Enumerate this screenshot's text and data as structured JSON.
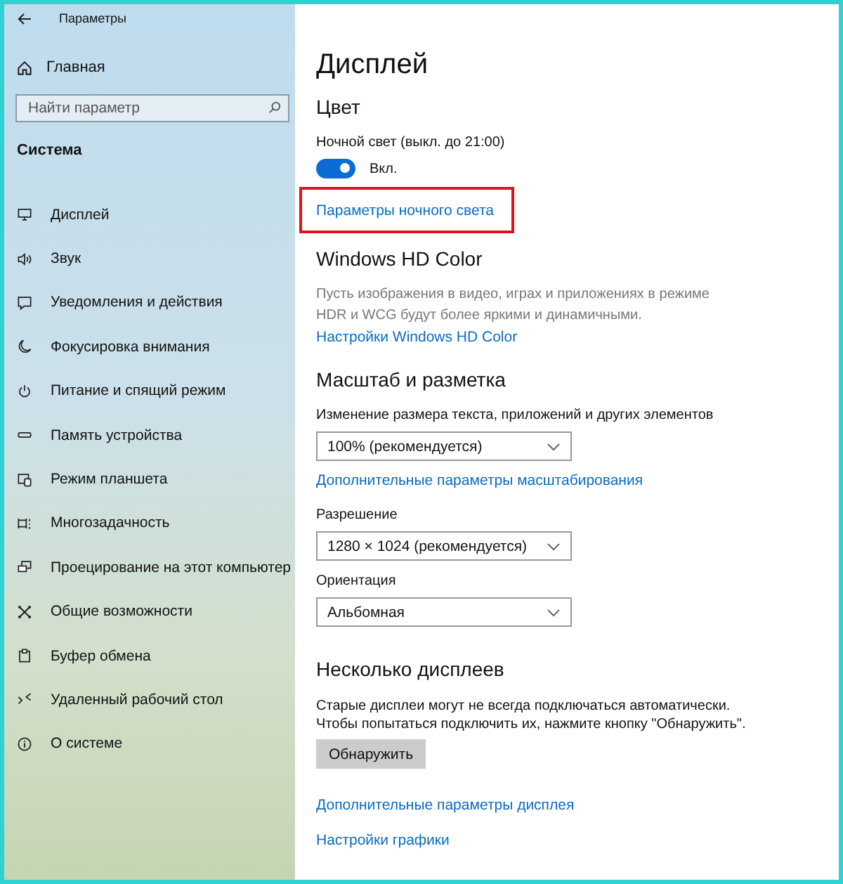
{
  "window": {
    "title": "Параметры"
  },
  "sidebar": {
    "home": "Главная",
    "search": {
      "placeholder": "Найти параметр"
    },
    "section": "Система",
    "items": [
      {
        "label": "Дисплей"
      },
      {
        "label": "Звук"
      },
      {
        "label": "Уведомления и действия"
      },
      {
        "label": "Фокусировка внимания"
      },
      {
        "label": "Питание и спящий режим"
      },
      {
        "label": "Память устройства"
      },
      {
        "label": "Режим планшета"
      },
      {
        "label": "Многозадачность"
      },
      {
        "label": "Проецирование на этот компьютер"
      },
      {
        "label": "Общие возможности"
      },
      {
        "label": "Буфер обмена"
      },
      {
        "label": "Удаленный рабочий стол"
      },
      {
        "label": "О системе"
      }
    ]
  },
  "content": {
    "title": "Дисплей",
    "color": {
      "heading": "Цвет",
      "night_light_label": "Ночной свет (выкл. до 21:00)",
      "toggle": {
        "on": true,
        "label": "Вкл."
      },
      "link": {
        "text": "Параметры ночного света",
        "highlighted": true
      }
    },
    "hd_color": {
      "heading": "Windows HD Color",
      "description": "Пусть изображения в видео, играх и приложениях в режиме HDR и WCG будут более яркими и динамичными.",
      "link": "Настройки Windows HD Color"
    },
    "scale": {
      "heading": "Масштаб и разметка",
      "scale_label": "Изменение размера текста, приложений и других элементов",
      "scale_value": "100% (рекомендуется)",
      "scale_link": "Дополнительные параметры масштабирования",
      "resolution_label": "Разрешение",
      "resolution_value": "1280 × 1024 (рекомендуется)",
      "orientation_label": "Ориентация",
      "orientation_value": "Альбомная"
    },
    "multi": {
      "heading": "Несколько дисплеев",
      "description": "Старые дисплеи могут не всегда подключаться автоматически. Чтобы попытаться подключить их, нажмите кнопку \"Обнаружить\".",
      "button": "Обнаружить"
    },
    "links": [
      "Дополнительные параметры дисплея",
      "Настройки графики"
    ]
  }
}
